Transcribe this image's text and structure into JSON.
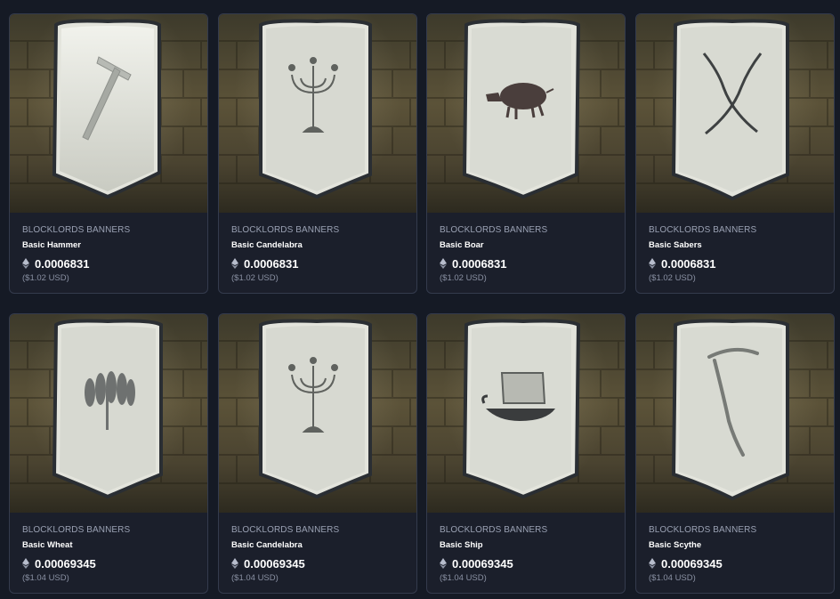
{
  "cards": [
    {
      "collection": "BLOCKLORDS BANNERS",
      "name": "Basic Hammer",
      "price": "0.0006831",
      "usd": "($1.02 USD)",
      "emblem": "hammer-emblem"
    },
    {
      "collection": "BLOCKLORDS BANNERS",
      "name": "Basic Candelabra",
      "price": "0.0006831",
      "usd": "($1.02 USD)",
      "emblem": "candelabra-emblem"
    },
    {
      "collection": "BLOCKLORDS BANNERS",
      "name": "Basic Boar",
      "price": "0.0006831",
      "usd": "($1.02 USD)",
      "emblem": "boar-emblem"
    },
    {
      "collection": "BLOCKLORDS BANNERS",
      "name": "Basic Sabers",
      "price": "0.0006831",
      "usd": "($1.02 USD)",
      "emblem": "sabers-emblem"
    },
    {
      "collection": "BLOCKLORDS BANNERS",
      "name": "Basic Wheat",
      "price": "0.00069345",
      "usd": "($1.04 USD)",
      "emblem": "wheat-emblem"
    },
    {
      "collection": "BLOCKLORDS BANNERS",
      "name": "Basic Candelabra",
      "price": "0.00069345",
      "usd": "($1.04 USD)",
      "emblem": "candelabra-emblem"
    },
    {
      "collection": "BLOCKLORDS BANNERS",
      "name": "Basic Ship",
      "price": "0.00069345",
      "usd": "($1.04 USD)",
      "emblem": "ship-emblem"
    },
    {
      "collection": "BLOCKLORDS BANNERS",
      "name": "Basic Scythe",
      "price": "0.00069345",
      "usd": "($1.04 USD)",
      "emblem": "scythe-emblem"
    }
  ],
  "currency_icon": "ethereum-icon",
  "colors": {
    "page_background": "#151a25",
    "card_background": "#1b1f2b",
    "card_border": "#343b4d",
    "collection_text": "#9aa1b3",
    "usd_text": "#8a91a3"
  }
}
